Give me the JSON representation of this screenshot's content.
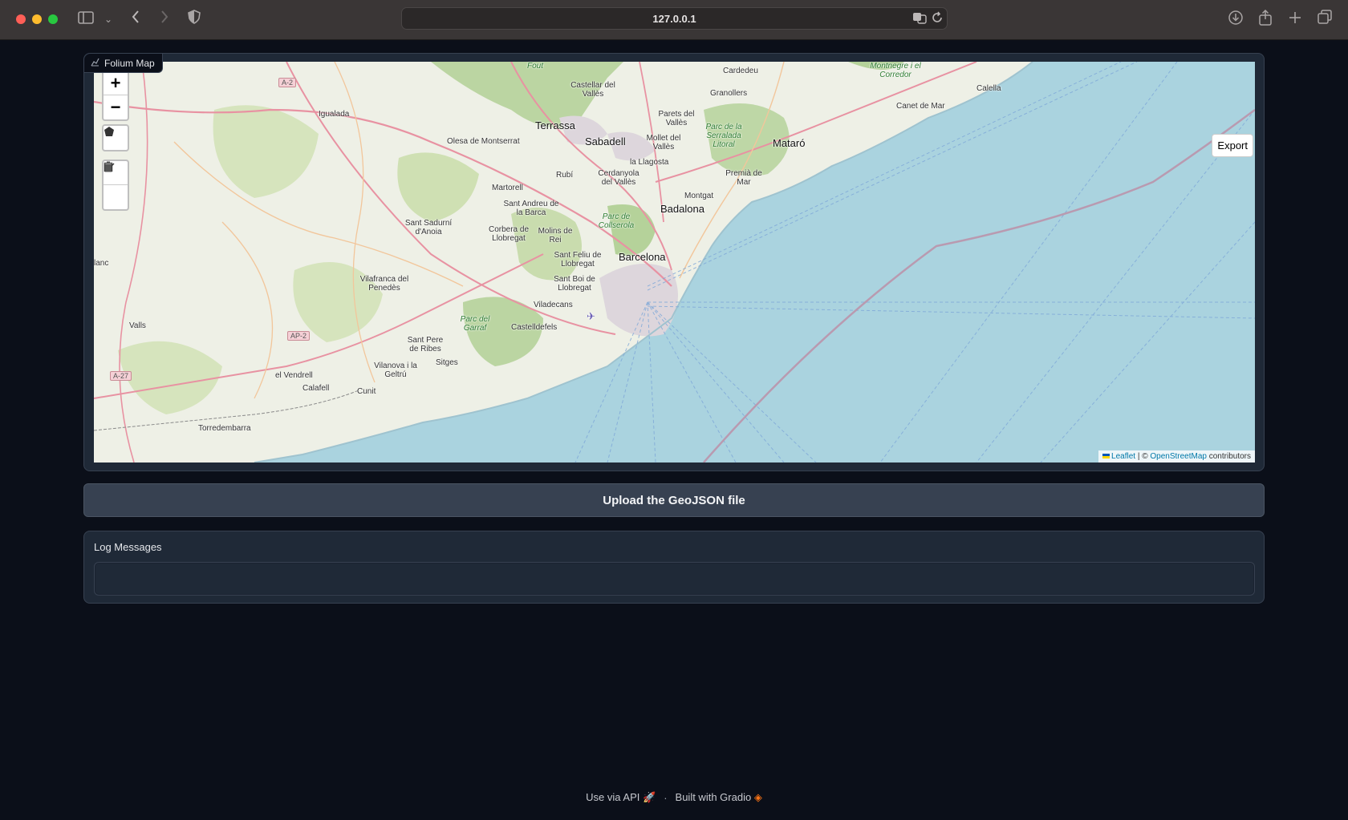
{
  "browser": {
    "url": "127.0.0.1",
    "icons": [
      "sidebar-icon",
      "chevron-down-icon",
      "back-icon",
      "forward-icon",
      "shield-icon",
      "translate-icon",
      "reload-icon",
      "download-icon",
      "share-icon",
      "new-tab-icon",
      "tabs-icon"
    ]
  },
  "map_block": {
    "label": "Folium Map",
    "controls": {
      "zoom_in": "+",
      "zoom_out": "−"
    },
    "export_label": "Export",
    "attribution": {
      "leaflet": "Leaflet",
      "sep": " | © ",
      "osm": "OpenStreetMap",
      "tail": " contributors"
    },
    "places": {
      "igualada": "Igualada",
      "castellar": "Castellar del Vallès",
      "cardedeu": "Cardedeu",
      "granollers": "Granollers",
      "montnegre": "Montnegre i el Corredor",
      "calella": "Calella",
      "canet": "Canet de Mar",
      "terrassa": "Terrassa",
      "parets": "Parets del Vallès",
      "olesa": "Olesa de Montserrat",
      "sabadell": "Sabadell",
      "mollet": "Mollet del Vallès",
      "serralada": "Parc de la Serralada Litoral",
      "mataro": "Mataró",
      "rubi": "Rubí",
      "lallagosta": "la Llagosta",
      "premia": "Premià de Mar",
      "martorell": "Martorell",
      "cerdanyola": "Cerdanyola del Vallès",
      "montgat": "Montgat",
      "santandreu": "Sant Andreu de la Barca",
      "badalona": "Badalona",
      "santsadurni": "Sant Sadurní d'Anoia",
      "corbera": "Corbera de Llobregat",
      "molins": "Molins de Rei",
      "collserola": "Parc de Collserola",
      "blanc": "lanc",
      "santfeliu": "Sant Feliu de Llobregat",
      "barcelona": "Barcelona",
      "vilafranca": "Vilafranca del Penedès",
      "santboi": "Sant Boi de Llobregat",
      "viladecans": "Viladecans",
      "garraf": "Parc del Garraf",
      "valls": "Valls",
      "castelldefels": "Castelldefels",
      "santpere": "Sant Pere de Ribes",
      "vilanova": "Vilanova i la Geltrú",
      "sitges": "Sitges",
      "vendrell": "el Vendrell",
      "calafell": "Calafell",
      "cunit": "Cunit",
      "torredembarra": "Torredembarra",
      "fout": "Fout",
      "a2": "A-2",
      "ap2": "AP-2",
      "a27": "A-27"
    }
  },
  "upload_button": {
    "label": "Upload the GeoJSON file"
  },
  "log": {
    "label": "Log Messages",
    "value": ""
  },
  "footer": {
    "api": "Use via API",
    "sep": "·",
    "gradio": "Built with Gradio"
  }
}
